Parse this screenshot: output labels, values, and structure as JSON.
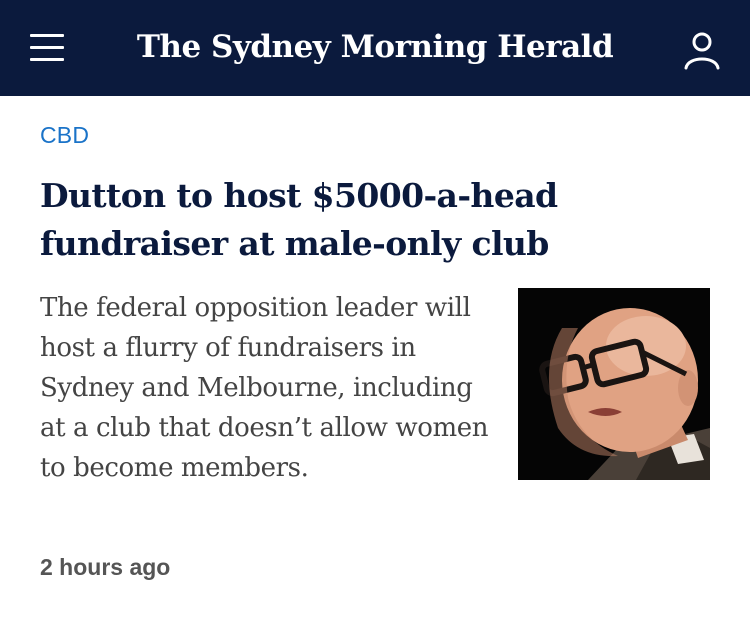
{
  "header": {
    "masthead": "The Sydney Morning Herald",
    "menu_icon": "hamburger-menu-icon",
    "account_icon": "user-account-icon",
    "background_color": "#0b1a3d"
  },
  "article": {
    "section": "CBD",
    "headline": "Dutton to host $5000-a-head fundraiser at male-only club",
    "summary": "The federal opposition leader will host a flurry of fundraisers in Sydney and Melbourne, including at a club that doesn’t allow women to become members.",
    "timestamp": "2 hours ago",
    "section_color": "#1a73c8"
  }
}
